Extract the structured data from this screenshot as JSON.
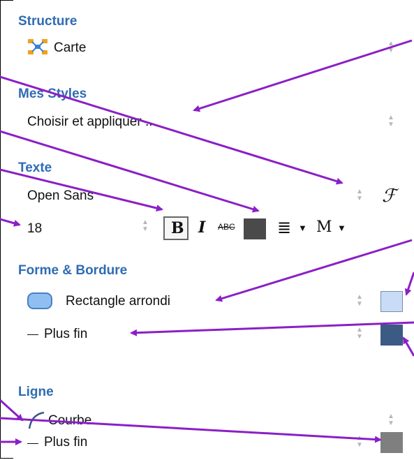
{
  "sections": {
    "structure": {
      "title": "Structure",
      "value": "Carte",
      "icon": "structure-map-icon"
    },
    "mystyles": {
      "title": "Mes Styles",
      "value": "Choisir et appliquer ..."
    },
    "text": {
      "title": "Texte",
      "font": "Open Sans",
      "size": "18",
      "bold": "B",
      "italic": "I",
      "strike": "ABC",
      "align_icon": "align-justify-icon",
      "case": "M",
      "font_icon": "script-f-icon",
      "color": "#4a4a4a"
    },
    "shape": {
      "title": "Forme & Bordure",
      "shape_value": "Rectangle arrondi",
      "border_value": "Plus fin",
      "fill_color": "#c9dcf7",
      "border_color": "#3b5b85",
      "shape_color": "#8fbff2"
    },
    "line": {
      "title": "Ligne",
      "style_value": "Courbe",
      "width_value": "Plus fin",
      "line_color": "#7f7f7f"
    }
  },
  "accent_arrow_color": "#8b1fc6"
}
